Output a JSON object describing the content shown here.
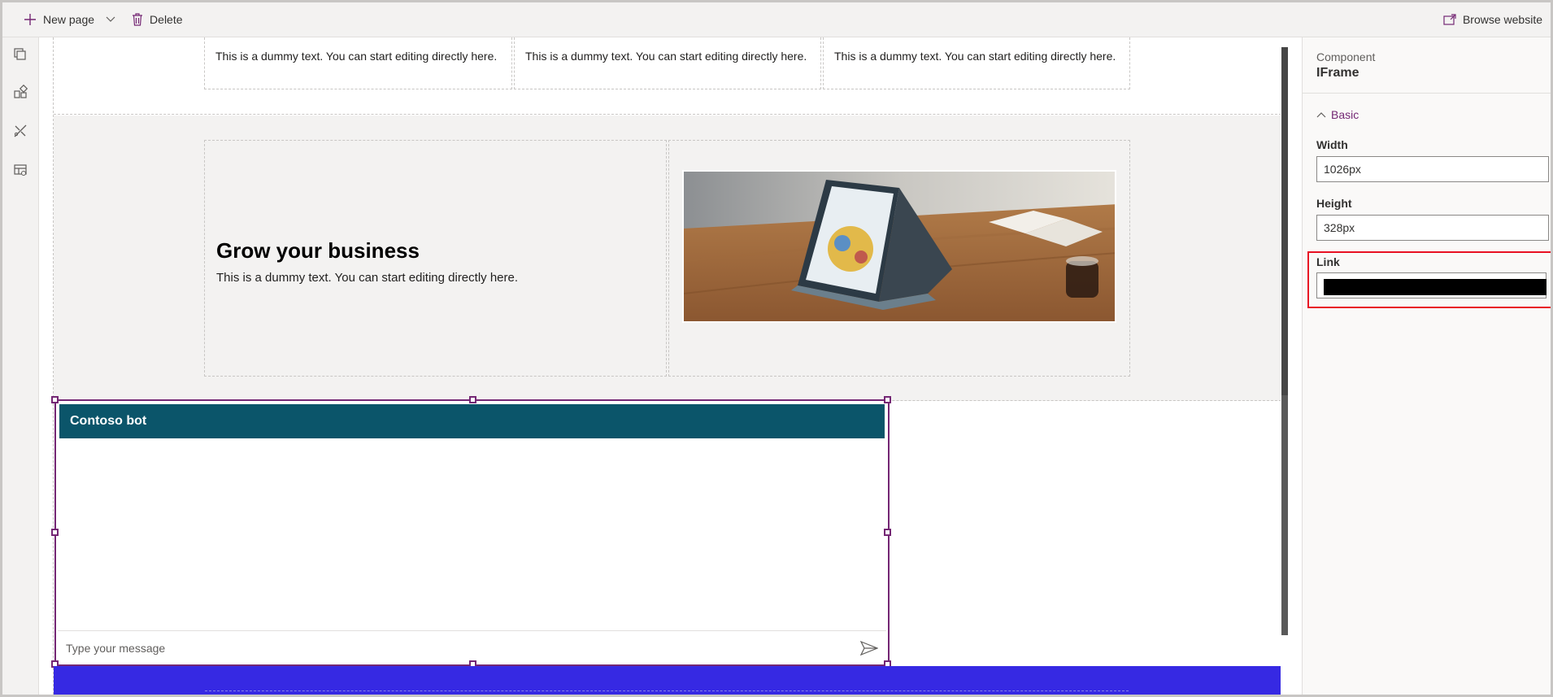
{
  "toolbar": {
    "new_page_label": "New page",
    "delete_label": "Delete",
    "browse_label": "Browse website"
  },
  "rail": {
    "items": [
      "pages-icon",
      "components-icon",
      "styling-icon",
      "data-icon"
    ]
  },
  "canvas": {
    "columns": [
      {
        "text": "This is a dummy text. You can start editing directly here."
      },
      {
        "text": "This is a dummy text. You can start editing directly here."
      },
      {
        "text": "This is a dummy text. You can start editing directly here."
      }
    ],
    "hero": {
      "title": "Grow your business",
      "text": "This is a dummy text. You can start editing directly here."
    },
    "bot": {
      "title": "Contoso bot",
      "input_placeholder": "Type your message"
    }
  },
  "panel": {
    "subtitle": "Component",
    "title": "IFrame",
    "section_label": "Basic",
    "fields": {
      "width_label": "Width",
      "width_value": "1026px",
      "height_label": "Height",
      "height_value": "328px",
      "link_label": "Link"
    }
  },
  "colors": {
    "accent": "#742774",
    "bot_header": "#0b556a",
    "blue_section": "#3629e3",
    "highlight": "#e81123"
  }
}
